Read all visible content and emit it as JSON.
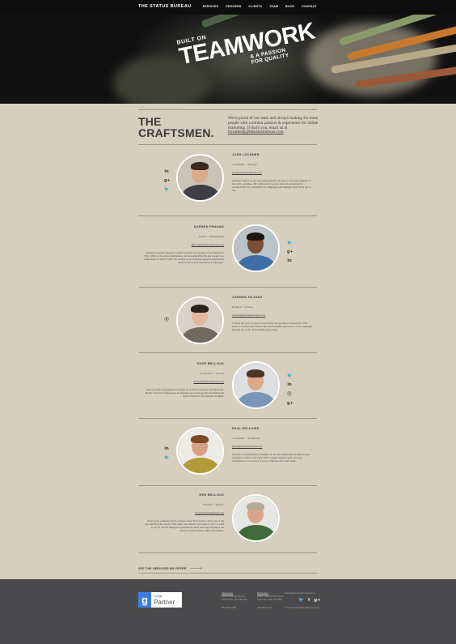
{
  "nav": {
    "brand": "THE STATUS BUREAU",
    "items": [
      "SERVICES",
      "PROCESS",
      "CLIENTS",
      "TEAM",
      "BLOG",
      "CONTACT"
    ]
  },
  "hero": {
    "pre": "BUILT ON",
    "main": "TEAMWORK",
    "post_line1": "& A PASSION",
    "post_line2": "FOR QUALITY"
  },
  "craftsmen": {
    "title_line1": "THE",
    "title_line2": "CRAFTSMEN.",
    "intro": "We're proud of our team and always looking for more people with a similar passion & experience for online marketing. If that's you, email us at",
    "intro_email": "fiveatdesk@thestatusbureau.com",
    "intro_end": "."
  },
  "team": [
    {
      "name": "JOSH LOCHNER",
      "role": "Co-founder + Strategy",
      "email": "josh@thestatusbureau.com",
      "bio": "Josh has worked in web and advertising for 12 years, is an active member of the GMC, AGMAA, BC AMA and is Google Adwords and Analytics certified. He's our contributor for campaigns and manages most of the day to day.",
      "socials": [
        "in",
        "g+",
        "tw"
      ]
    },
    {
      "name": "DARREN PRASAD",
      "role": "Tactics + Management",
      "email": "darren@thestatusbureau.com",
      "bio": "Darren is Google Adwords Certified and has over 6 years of specializing in SEO, SEM, Conversion Optimization, & increasing ROI. He has worked as a team leader on major Profit 100 website re-development projects and handles much of the tactical execution of campaigns.",
      "socials": [
        "tw",
        "g+",
        "in"
      ]
    },
    {
      "name": "CARMEN HAJDAU",
      "role": "Platform + Design",
      "email": "carmen@thestatusbureau.com",
      "bio": "Carmen has over 12 years of advertising and production experience. This leads to a professional end product and beautiful approach to every campaign, keeping our work, and branding impeccable.",
      "socials": [
        "pin"
      ]
    },
    {
      "name": "DAVE BELLOUS",
      "role": "Co-founder + Success",
      "email": "dave@thestatusbureau.com",
      "bio": "Dave provides management oversight on technical direction and financials. He has 16 years of experience in ensuring successful growth and finding the right solution for any business problem.",
      "socials": [
        "tw",
        "in",
        "pin",
        "g+"
      ]
    },
    {
      "name": "PAUL SELLOWS",
      "role": "Co-founder + Leadership",
      "email": "paul@thestatusbureau.com",
      "bio": "Paul has an management oversight role for The Status Bureau. His 20 years experience on his work allows him to gauge business goals and stay disciplined on core policy of every campaign and relationship.",
      "socials": [
        "in",
        "tw"
      ]
    },
    {
      "name": "KEN BELLOUS",
      "role": "Founder + Partner",
      "email": "ken@thestatusbureau.com",
      "bio": "Every great company needs a mentor team. We're lucky to have one of the best minds in the country. Ken audits our numbers and ensures we're as solid as we fly. He has managed organizations small and large and keeps the structure of the business tight and together.",
      "socials": []
    }
  ],
  "services_link": "SEE THE SERVICES WE OFFER",
  "services_arrow": "——⟶",
  "footer": {
    "badge_small": "Google",
    "badge_big": "Partner",
    "col1_head": "Vancouver",
    "col1_lines": [
      "1123 1/2 West Pender",
      "Vancouver, BC V6E 2S1"
    ],
    "col1_foot": "604 555 1234",
    "col2_head": "Edmonton",
    "col2_lines": [
      "4001 - 10125 109 Street",
      "Edmonton AB T5J 3M1"
    ],
    "col2_foot": "780 555 1234",
    "email": "hello@thestatusbureau.com",
    "copyright": "© 2015 The Status Bureau Corp."
  },
  "colors": {
    "page_bg": "#d6cfbd",
    "nav_bg": "#0d0d0d",
    "footer_bg": "#4a4a4c",
    "text": "#3b3b3b"
  }
}
